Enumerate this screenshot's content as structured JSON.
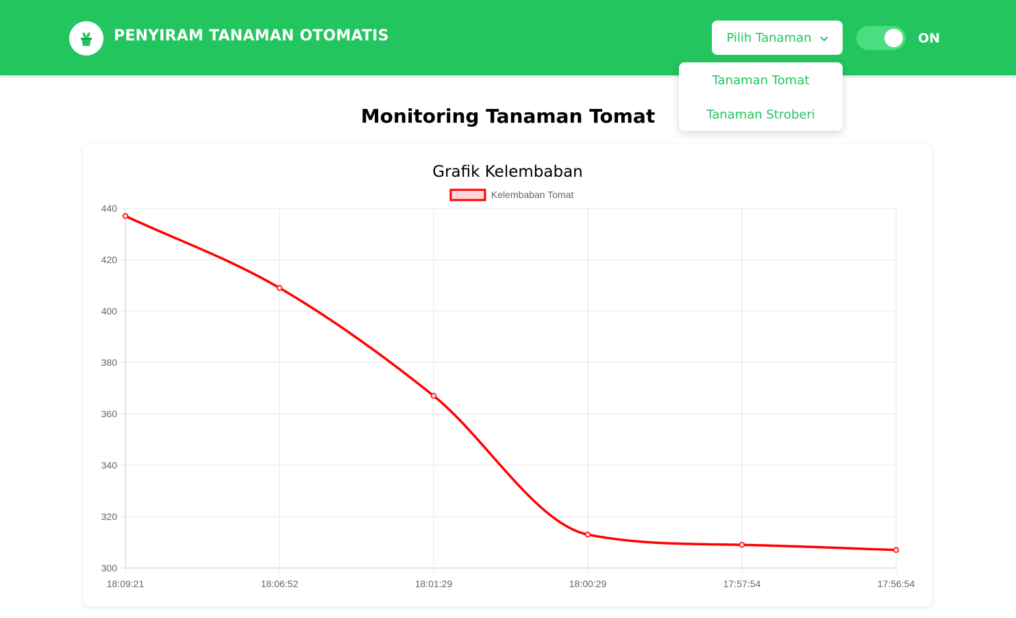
{
  "header": {
    "app_title": "PENYIRAM TANAMAN OTOMATIS",
    "logo_icon": "plant-pot-icon",
    "select_label": "Pilih Tanaman",
    "toggle_label": "ON",
    "toggle_on": true,
    "accent_color": "#22c55e"
  },
  "dropdown": {
    "items": [
      "Tanaman Tomat",
      "Tanaman Stroberi"
    ]
  },
  "main": {
    "page_title": "Monitoring Tanaman Tomat"
  },
  "chart_data": {
    "type": "line",
    "title": "Grafik Kelembaban",
    "categories": [
      "18:09:21",
      "18:06:52",
      "18:01:29",
      "18:00:29",
      "17:57:54",
      "17:56:54"
    ],
    "series": [
      {
        "name": "Kelembaban Tomat",
        "values": [
          437,
          409,
          367,
          313,
          309,
          307
        ],
        "color": "#ff0000",
        "fill": "#ffd6dc"
      }
    ],
    "yticks": [
      300,
      320,
      340,
      360,
      380,
      400,
      420,
      440
    ],
    "ylim": [
      300,
      440
    ],
    "grid": true,
    "legend": "top-center",
    "xlabel": "",
    "ylabel": ""
  }
}
